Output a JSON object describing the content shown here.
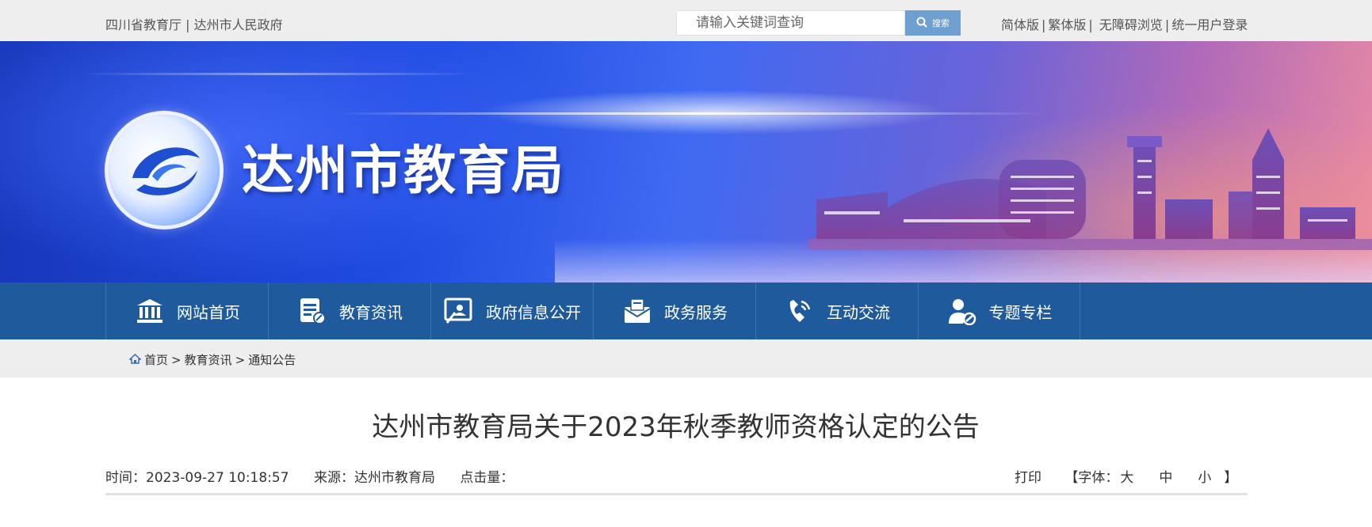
{
  "topbar": {
    "link_province": "四川省教育厅",
    "divider": "|",
    "link_city_gov": "达州市人民政府",
    "search_placeholder": "请输入关键词查询",
    "search_button": "搜索",
    "links": {
      "simplified": "简体版",
      "traditional": "繁体版",
      "accessible": "无障碍浏览",
      "login": "统一用户登录"
    }
  },
  "banner": {
    "site_title": "达州市教育局"
  },
  "nav": {
    "items": [
      {
        "label": "网站首页",
        "icon": "home-building-icon"
      },
      {
        "label": "教育资讯",
        "icon": "news-document-icon"
      },
      {
        "label": "政府信息公开",
        "icon": "gov-info-icon"
      },
      {
        "label": "政务服务",
        "icon": "service-envelope-icon"
      },
      {
        "label": "互动交流",
        "icon": "phone-icon"
      },
      {
        "label": "专题专栏",
        "icon": "user-topic-icon"
      }
    ]
  },
  "breadcrumb": {
    "home": "首页",
    "level1": "教育资讯",
    "level2": "通知公告",
    "sep": ">"
  },
  "article": {
    "title": "达州市教育局关于2023年秋季教师资格认定的公告",
    "time_label": "时间：",
    "time_value": "2023-09-27 10:18:57",
    "source_label": "来源：",
    "source_value": "达州市教育局",
    "views_label": "点击量：",
    "print": "打印",
    "font_open": "【字体：",
    "font_large": "大",
    "font_medium": "中",
    "font_small": "小",
    "font_close": "】"
  },
  "colors": {
    "nav_bg": "#1f5a9c",
    "search_button": "#6d9fd0",
    "bar_bg": "#eeeeee"
  }
}
